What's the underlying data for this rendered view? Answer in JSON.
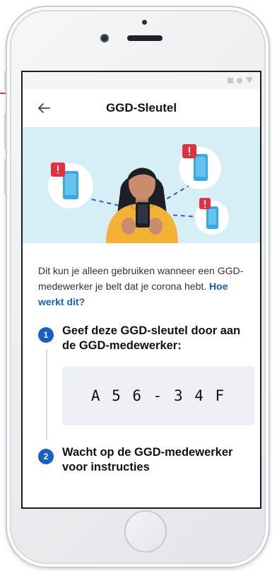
{
  "colors": {
    "accent_blue": "#1860c8",
    "hero_bg": "#d6eef5",
    "code_bg": "#eef0f5",
    "alert_red": "#e5303c",
    "person_yellow": "#f2b233"
  },
  "appbar": {
    "title": "GGD-Sleutel",
    "back_icon": "arrow-left-icon"
  },
  "intro": {
    "text": "Dit kun je alleen gebruiken wanneer een GGD-medewerker je belt dat je corona hebt.",
    "link": "Hoe werkt dit?"
  },
  "steps": [
    {
      "number": "1",
      "title": "Geef deze GGD-sleutel door aan de GGD-medewerker:",
      "code": "A 5 6 - 3 4 F"
    },
    {
      "number": "2",
      "title": "Wacht op de GGD-medewerker voor instructies"
    }
  ],
  "statusbar": {
    "icons": [
      "square-icon",
      "circle-icon",
      "triangle-icon"
    ]
  }
}
